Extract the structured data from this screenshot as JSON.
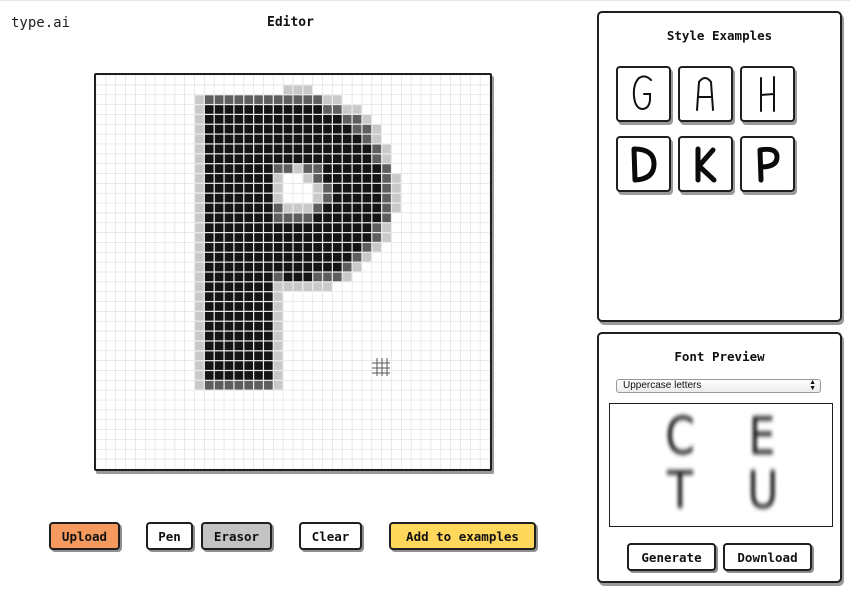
{
  "app": {
    "brand": "type.ai",
    "editor_title": "Editor"
  },
  "editor": {
    "grid_cells": 40,
    "brush_cursor_icon": "grid-cursor-icon"
  },
  "toolbar": {
    "upload_label": "Upload",
    "pen_label": "Pen",
    "eraser_label": "Erasor",
    "clear_label": "Clear",
    "add_label": "Add to examples"
  },
  "style_examples": {
    "title": "Style Examples",
    "items": [
      {
        "letter": "G",
        "style": "thin"
      },
      {
        "letter": "A",
        "style": "thin"
      },
      {
        "letter": "H",
        "style": "thin"
      },
      {
        "letter": "D",
        "style": "bold"
      },
      {
        "letter": "K",
        "style": "bold"
      },
      {
        "letter": "P",
        "style": "bold"
      }
    ]
  },
  "font_preview": {
    "title": "Font Preview",
    "select_value": "Uppercase letters",
    "letters_row1": [
      "C",
      "E"
    ],
    "letters_row2": [
      "T",
      "U"
    ],
    "generate_label": "Generate",
    "download_label": "Download"
  },
  "colors": {
    "upload_bg": "#f59a5e",
    "eraser_bg": "#c3c3c3",
    "add_bg": "#ffd75a",
    "border": "#1f1f1f"
  }
}
